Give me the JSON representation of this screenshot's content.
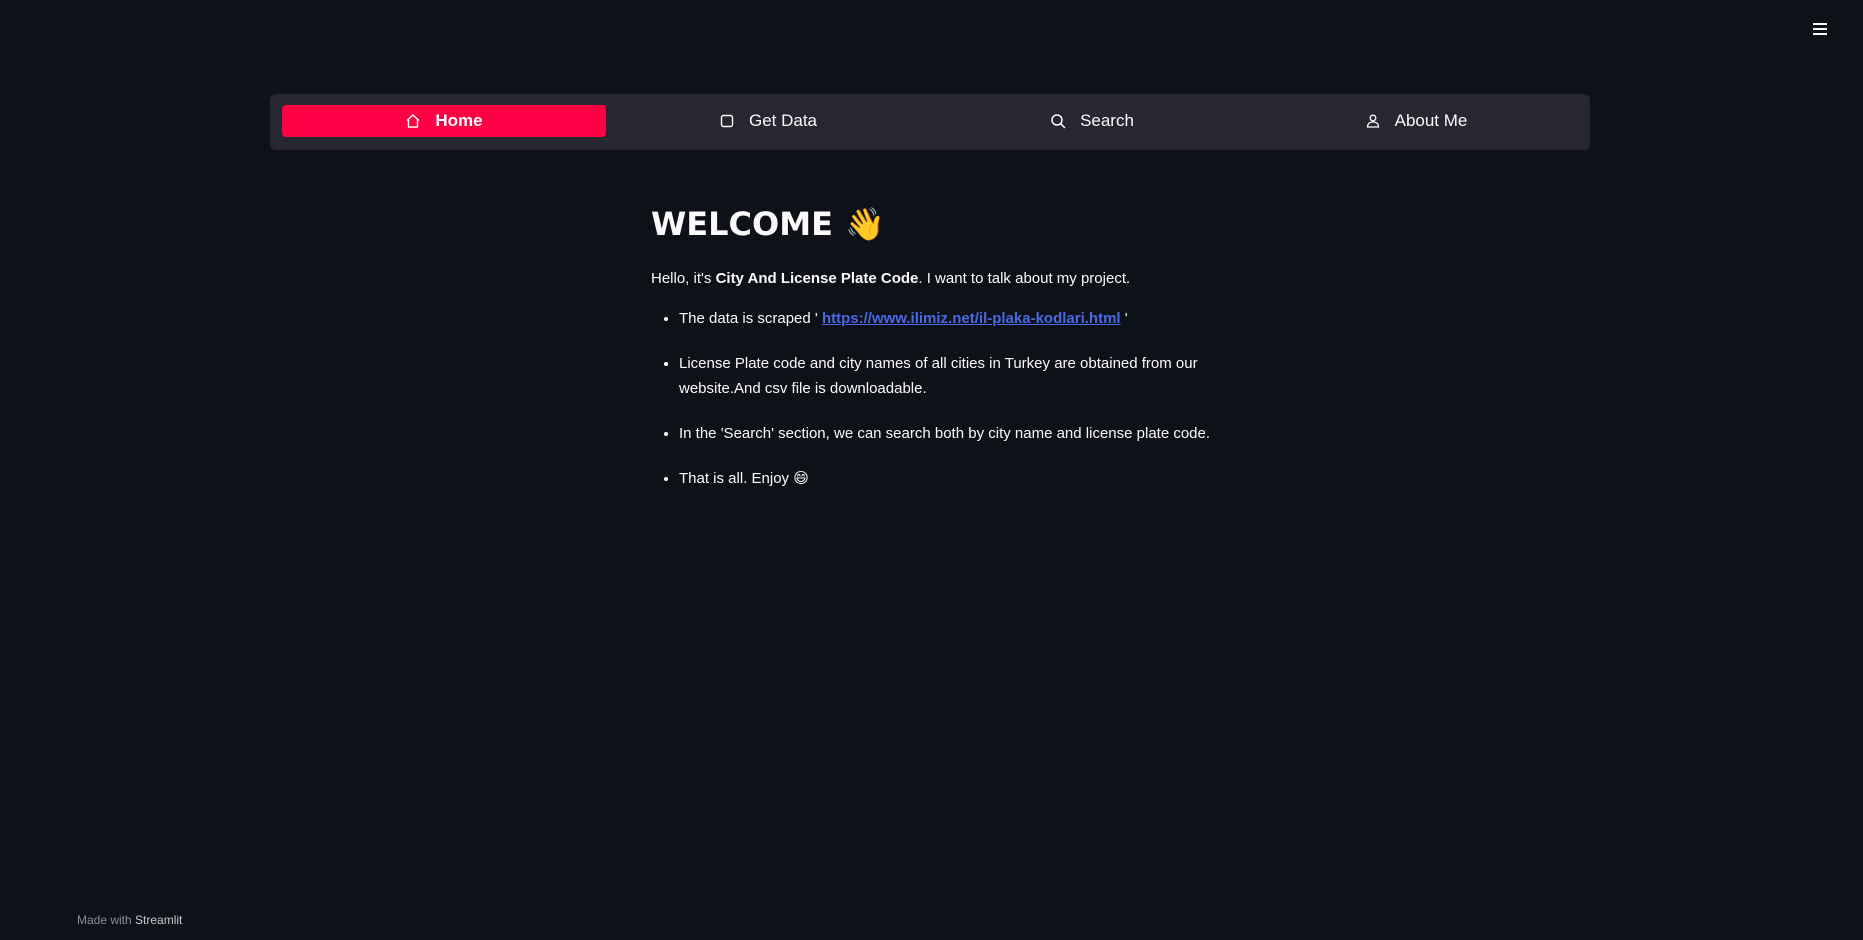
{
  "app": {
    "menu_icon": "hamburger-icon"
  },
  "nav": {
    "items": [
      {
        "label": "Home",
        "icon": "home-icon",
        "active": true
      },
      {
        "label": "Get Data",
        "icon": "square-icon",
        "active": false
      },
      {
        "label": "Search",
        "icon": "search-icon",
        "active": false
      },
      {
        "label": "About Me",
        "icon": "person-icon",
        "active": false
      }
    ],
    "active_color": "#ff0044"
  },
  "main": {
    "title": "WELCOME",
    "title_emoji": "👋",
    "intro_prefix": "Hello, it's ",
    "intro_bold": "City And License Plate Code",
    "intro_suffix": ". I want to talk about my project.",
    "bullets": {
      "b1_prefix": "The data is scraped ' ",
      "b1_link": "https://www.ilimiz.net/il-plaka-kodlari.html",
      "b1_suffix": " '",
      "b2": "License Plate code and city names of all cities in Turkey are obtained from our website.And csv file is downloadable.",
      "b3": "In the 'Search' section, we can search both by city name and license plate code.",
      "b4_text": "That is all. Enjoy ",
      "b4_emoji": "😄"
    }
  },
  "footer": {
    "prefix": "Made with ",
    "brand": "Streamlit"
  }
}
